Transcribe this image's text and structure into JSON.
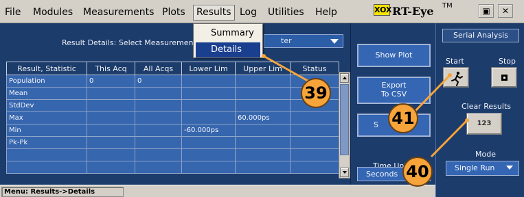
{
  "menubar": {
    "items": [
      "File",
      "Modules",
      "Measurements",
      "Plots",
      "Results",
      "Log",
      "Utilities",
      "Help"
    ],
    "active": "Results",
    "brand": {
      "logo_text": "XOX",
      "name": "RT-Eye",
      "tm": "TM"
    }
  },
  "results_menu": {
    "items": [
      "Summary",
      "Details"
    ],
    "selected": "Details"
  },
  "result_details": {
    "label": "Result Details: Select Measurement",
    "dropdown_value": "ter"
  },
  "table": {
    "columns": [
      "Result, Statistic",
      "This Acq",
      "All Acqs",
      "Lower Lim",
      "Upper Lim",
      "Status"
    ],
    "rows": [
      [
        "Population",
        "0",
        "0",
        "",
        "",
        ""
      ],
      [
        "Mean",
        "",
        "",
        "",
        "",
        ""
      ],
      [
        "StdDev",
        "",
        "",
        "",
        "",
        ""
      ],
      [
        "Max",
        "",
        "",
        "",
        "60.000ps",
        ""
      ],
      [
        "Min",
        "",
        "",
        "-60.000ps",
        "",
        ""
      ],
      [
        "Pk-Pk",
        "",
        "",
        "",
        "",
        ""
      ],
      [
        "",
        "",
        "",
        "",
        "",
        ""
      ],
      [
        "",
        "",
        "",
        "",
        "",
        ""
      ]
    ]
  },
  "actions": {
    "show_plot": "Show Plot",
    "export_line1": "Export",
    "export_line2": "To CSV",
    "hidden_btn_prefix": "S",
    "time_units_label": "Time Unit",
    "time_units_value": "Seconds"
  },
  "serial_analysis": {
    "title": "Serial Analysis",
    "start_label": "Start",
    "stop_label": "Stop",
    "clear_label": "Clear Results",
    "clear_icon_text": "123",
    "mode_label": "Mode",
    "mode_value": "Single Run"
  },
  "status_bar": {
    "text": "Menu: Results->Details"
  },
  "callouts": [
    "39",
    "40",
    "41"
  ],
  "colors": {
    "panel": "#1c3c6c",
    "cell": "#3666ae",
    "callout": "#f7a43b",
    "menu_highlight": "#1b3f8f"
  }
}
